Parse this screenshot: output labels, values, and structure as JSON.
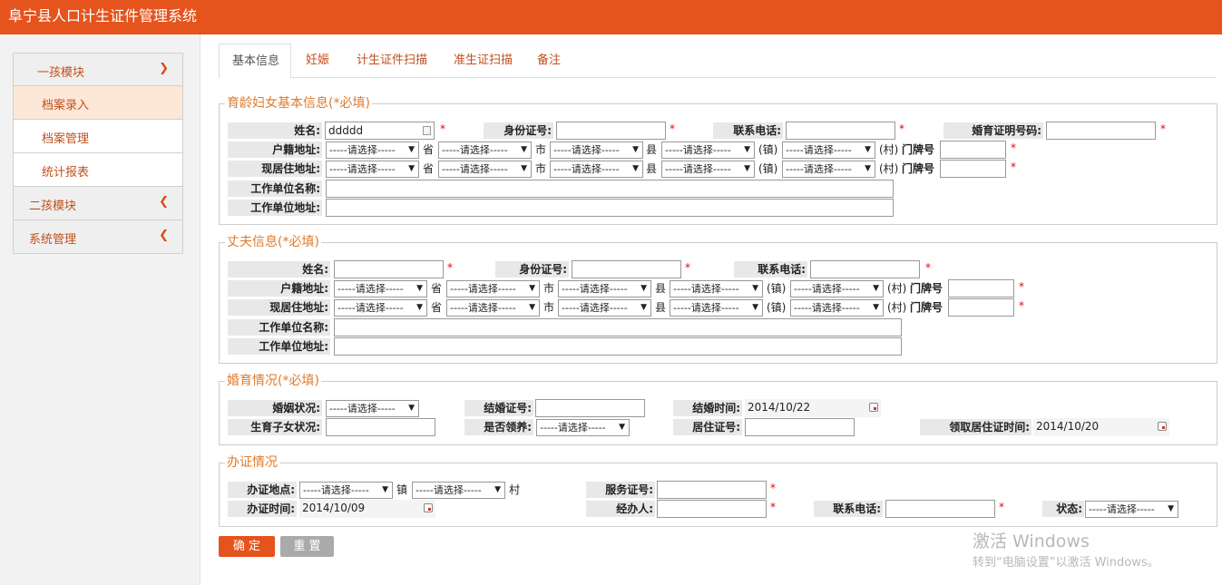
{
  "app": {
    "title": "阜宁县人口计生证件管理系统"
  },
  "sidebar": {
    "modules": [
      {
        "label": "一孩模块",
        "expanded": true,
        "items": [
          {
            "label": "档案录入",
            "active": true
          },
          {
            "label": "档案管理",
            "active": false
          },
          {
            "label": "统计报表",
            "active": false
          }
        ]
      },
      {
        "label": "二孩模块",
        "expanded": false
      },
      {
        "label": "系统管理",
        "expanded": false
      }
    ]
  },
  "tabs": [
    "基本信息",
    "妊娠",
    "计生证件扫描",
    "准生证扫描",
    "备注"
  ],
  "common": {
    "select_placeholder": "-----请选择-----",
    "province": "省",
    "city": "市",
    "county": "县",
    "town": "(镇)",
    "village": "(村)",
    "house_no": "门牌号",
    "town_plain": "镇",
    "village_plain": "村",
    "required_mark": "*"
  },
  "woman": {
    "legend": "育龄妇女基本信息(*必填)",
    "name_label": "姓名:",
    "name_value": "ddddd",
    "id_label": "身份证号:",
    "id_value": "",
    "phone_label": "联系电话:",
    "phone_value": "",
    "cert_label": "婚育证明号码:",
    "cert_value": "",
    "huji_label": "户籍地址:",
    "live_label": "现居住地址:",
    "work_name_label": "工作单位名称:",
    "work_addr_label": "工作单位地址:"
  },
  "husband": {
    "legend": "丈夫信息(*必填)",
    "name_label": "姓名:",
    "id_label": "身份证号:",
    "phone_label": "联系电话:",
    "huji_label": "户籍地址:",
    "live_label": "现居住地址:",
    "work_name_label": "工作单位名称:",
    "work_addr_label": "工作单位地址:"
  },
  "marriage": {
    "legend": "婚育情况(*必填)",
    "marital_label": "婚姻状况:",
    "marriage_cert_label": "结婚证号:",
    "marriage_date_label": "结婚时间:",
    "marriage_date_value": "2014/10/22",
    "children_label": "生育子女状况:",
    "adopted_label": "是否领养:",
    "residence_label": "居住证号:",
    "residence_date_label": "领取居住证时间:",
    "residence_date_value": "2014/10/20"
  },
  "process": {
    "legend": "办证情况",
    "place_label": "办证地点:",
    "service_no_label": "服务证号:",
    "date_label": "办证时间:",
    "date_value": "2014/10/09",
    "handler_label": "经办人:",
    "phone_label": "联系电话:",
    "status_label": "状态:"
  },
  "buttons": {
    "confirm": "确 定",
    "reset": "重 置"
  },
  "watermark": {
    "line1": "激活 Windows",
    "line2": "转到“电脑设置”以激活 Windows。"
  },
  "colors": {
    "brand": "#e5541c",
    "legend": "#e07a2a",
    "required": "#ee0000"
  }
}
